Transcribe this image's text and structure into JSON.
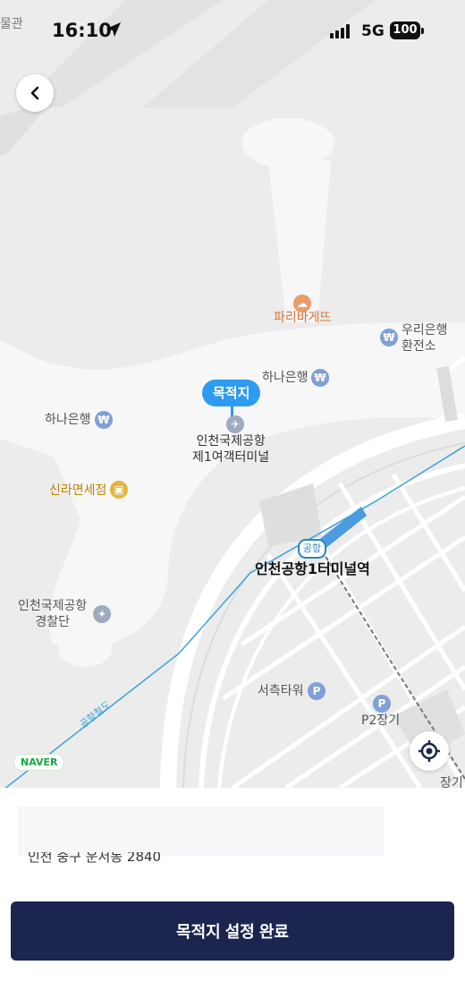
{
  "status_bar": {
    "time": "16:10",
    "network": "5G",
    "battery": "100",
    "corner_text": "물관"
  },
  "map": {
    "pois": {
      "paris_baguette": "파리바게뜨",
      "woori_bank": "우리은행\n환전소",
      "hana_bank_1": "하나은행",
      "hana_bank_2": "하나은행",
      "shilla": "신라면세점",
      "police": "인천국제공항\n경찰단",
      "terminal": "인천국제공항\n제1여객터미널",
      "station": "인천공항1터미널역",
      "seochuk": "서측타워",
      "p2": "P2장기",
      "long_term": "장기"
    },
    "destination_label": "목적지",
    "station_badge": "공항",
    "rail_label": "공항철도",
    "brand": "NAVER"
  },
  "sheet": {
    "address": "인천 중구 운서동 2840",
    "confirm_label": "목적지 설정 완료"
  },
  "colors": {
    "accent_blue": "#2e9bf0",
    "confirm_bg": "#1b2550",
    "map_bg": "#ececec"
  }
}
